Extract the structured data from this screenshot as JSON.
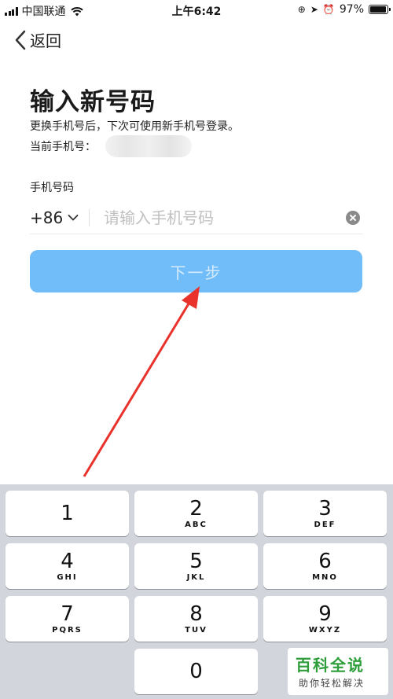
{
  "status_bar": {
    "carrier": "中国联通",
    "time": "上午6:42",
    "battery": "97%",
    "battery_level": 0.97,
    "icons": [
      "signal-icon",
      "wifi-icon",
      "orientation-lock-icon",
      "location-icon",
      "alarm-icon",
      "battery-icon"
    ]
  },
  "nav": {
    "back_label": "返回"
  },
  "page": {
    "title": "输入新号码",
    "description": "更换手机号后，下次可使用新手机号登录。",
    "current_phone_label": "当前手机号："
  },
  "form": {
    "phone_label": "手机号码",
    "country_code": "+86",
    "phone_value": "",
    "phone_placeholder": "请输入手机号码",
    "next_button": "下一步"
  },
  "keyboard": {
    "keys": [
      {
        "num": "1",
        "letters": ""
      },
      {
        "num": "2",
        "letters": "ABC"
      },
      {
        "num": "3",
        "letters": "DEF"
      },
      {
        "num": "4",
        "letters": "GHI"
      },
      {
        "num": "5",
        "letters": "JKL"
      },
      {
        "num": "6",
        "letters": "MNO"
      },
      {
        "num": "7",
        "letters": "PQRS"
      },
      {
        "num": "8",
        "letters": "TUV"
      },
      {
        "num": "9",
        "letters": "WXYZ"
      },
      {
        "num": "0",
        "letters": ""
      }
    ]
  },
  "watermark": {
    "title": "百科全说",
    "subtitle": "助你轻松解决"
  },
  "colors": {
    "accent": "#71bdf9",
    "keyboard_bg": "#d2d5db",
    "annotation": "#e8322b",
    "watermark_green": "#2e9e3a"
  }
}
